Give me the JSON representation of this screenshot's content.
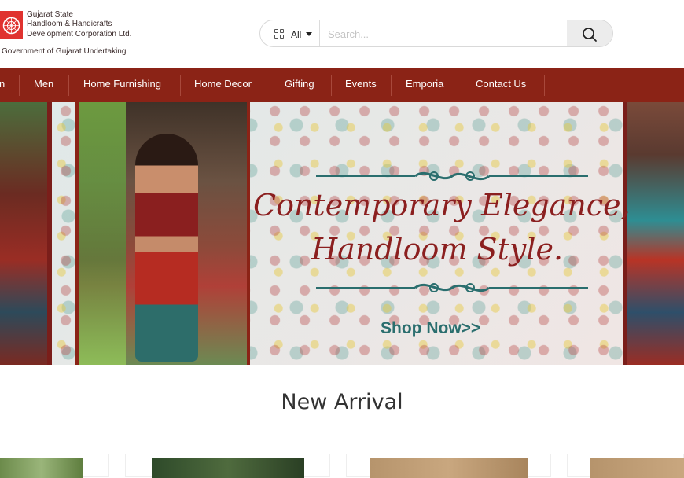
{
  "header": {
    "logo_line1": "Gujarat State",
    "logo_line2": "Handloom & Handicrafts",
    "logo_line3": "Development Corporation Ltd.",
    "logo_tagline": "Government of Gujarat Undertaking"
  },
  "search": {
    "category_label": "All",
    "placeholder": "Search...",
    "value": ""
  },
  "nav": {
    "items": [
      {
        "label": "n"
      },
      {
        "label": "Men"
      },
      {
        "label": "Home Furnishing"
      },
      {
        "label": "Home Decor"
      },
      {
        "label": "Gifting"
      },
      {
        "label": "Events"
      },
      {
        "label": "Emporia"
      },
      {
        "label": "Contact Us"
      }
    ]
  },
  "banner": {
    "headline_line1": "Contemporary Elegance,",
    "headline_line2": "Handloom Style.",
    "cta": "Shop Now>>"
  },
  "sections": {
    "new_arrival_title": "New Arrival"
  },
  "colors": {
    "brand": "#8b2316",
    "logo_red": "#e0322f",
    "headline": "#8b1f1f",
    "cta": "#2a6e6e"
  },
  "icons": {
    "category": "grid-icon",
    "dropdown": "caret-down-icon",
    "search": "search-icon",
    "logo": "gujarat-emblem-icon"
  }
}
